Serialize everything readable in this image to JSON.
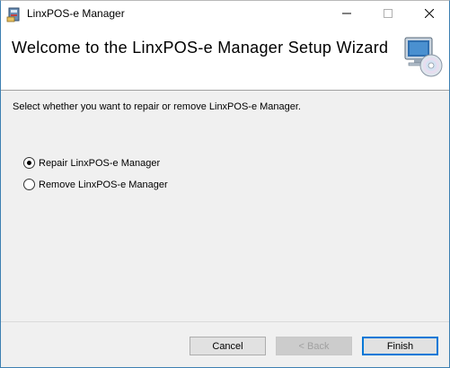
{
  "window": {
    "title": "LinxPOS-e Manager",
    "icons": {
      "app": "installer-package-icon",
      "minimize": "minimize-icon",
      "maximize": "maximize-icon",
      "close": "close-icon",
      "header_art": "computer-with-cd-icon"
    }
  },
  "header": {
    "title": "Welcome to the LinxPOS-e Manager Setup Wizard"
  },
  "body": {
    "instruction": "Select whether you want to repair or remove LinxPOS-e Manager.",
    "options": [
      {
        "label": "Repair LinxPOS-e Manager",
        "selected": true
      },
      {
        "label": "Remove LinxPOS-e Manager",
        "selected": false
      }
    ]
  },
  "footer": {
    "cancel_label": "Cancel",
    "back_label": "< Back",
    "finish_label": "Finish",
    "back_enabled": false,
    "default_button": "Finish"
  },
  "colors": {
    "accent": "#0078d7",
    "dialog_bg": "#f0f0f0",
    "header_bg": "#ffffff"
  }
}
